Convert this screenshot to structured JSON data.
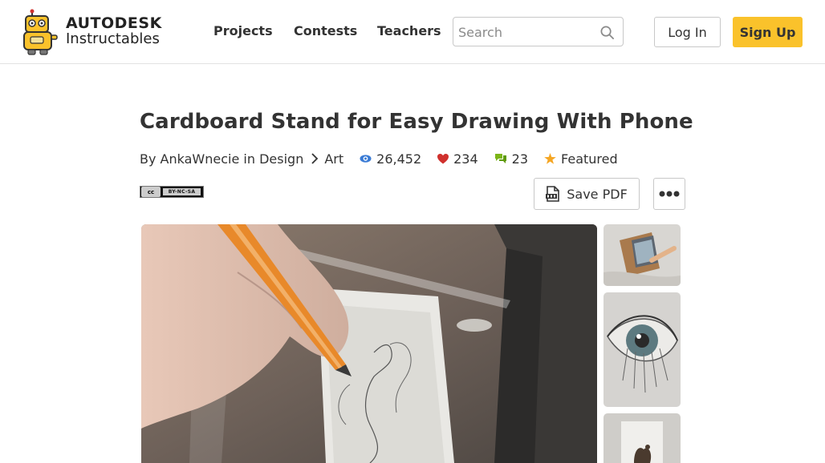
{
  "header": {
    "logo_line1": "AUTODESK",
    "logo_line2": "Instructables",
    "nav": [
      "Projects",
      "Contests",
      "Teachers"
    ],
    "search_placeholder": "Search",
    "login_label": "Log In",
    "signup_label": "Sign Up"
  },
  "article": {
    "title": "Cardboard Stand for Easy Drawing With Phone",
    "by_prefix": "By",
    "author": "AnkaWnecie",
    "in_word": "in",
    "category": "Design",
    "subcategory": "Art",
    "views": "26,452",
    "favorites": "234",
    "comments": "23",
    "featured_label": "Featured",
    "license_text": "BY-NC-SA",
    "license_cc": "cc",
    "save_pdf_label": "Save PDF"
  },
  "icons": {
    "logo": "robot-logo-icon",
    "search": "search-icon",
    "chevron": "chevron-right-icon",
    "views": "eye-icon",
    "favorites": "heart-icon",
    "comments": "chat-bubbles-icon",
    "featured": "star-icon",
    "pdf": "pdf-file-icon",
    "more": "more-dots-icon"
  },
  "colors": {
    "accent": "#fac22b",
    "eye": "#3a7bd5",
    "heart": "#d0312d",
    "comments": "#7cb518",
    "star": "#f5a623"
  }
}
